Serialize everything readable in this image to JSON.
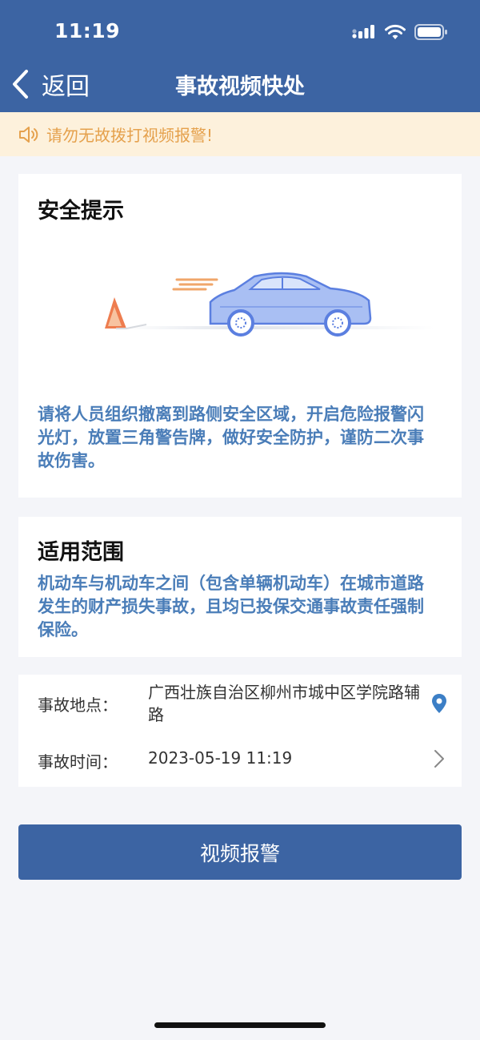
{
  "status_bar": {
    "time": "11:19"
  },
  "nav": {
    "back_label": "返回",
    "title": "事故视频快处"
  },
  "notice": {
    "text": "请勿无故拨打视频报警!"
  },
  "safety": {
    "title": "安全提示",
    "text": "请将人员组织撤离到路侧安全区域，开启危险报警闪光灯，放置三角警告牌，做好安全防护，谨防二次事故伤害。"
  },
  "scope": {
    "title": "适用范围",
    "text": "机动车与机动车之间（包含单辆机动车）在城市道路发生的财产损失事故，且均已投保交通事故责任强制保险。"
  },
  "accident_info": {
    "location_label": "事故地点：",
    "location_value": "广西壮族自治区柳州市城中区学院路辅路",
    "time_label": "事故时间：",
    "time_value": "2023-05-19 11:19"
  },
  "action": {
    "video_alarm_label": "视频报警"
  },
  "colors": {
    "primary": "#3c64a3",
    "notice_bg": "#fdf1dc",
    "notice_text": "#e5a14d",
    "info_text": "#4a7db8"
  }
}
